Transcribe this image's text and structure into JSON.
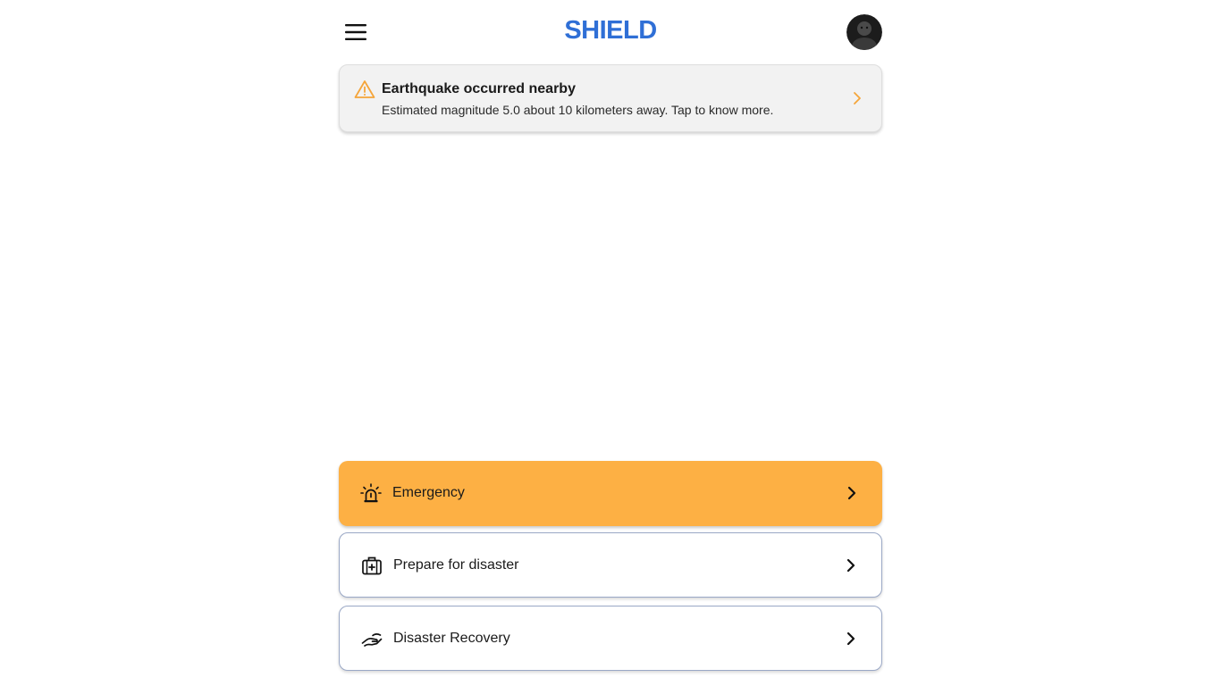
{
  "header": {
    "logo": "SHIELD",
    "menu_icon": "hamburger-menu-icon",
    "avatar_icon": "user-avatar"
  },
  "alert": {
    "icon": "warning-triangle-icon",
    "title": "Earthquake occurred nearby",
    "description": "Estimated magnitude 5.0 about 10 kilometers away. Tap to know more.",
    "accent_color": "#f5a53a"
  },
  "actions": [
    {
      "label": "Emergency",
      "icon": "siren-icon",
      "style": "primary",
      "color": "#fdb044"
    },
    {
      "label": "Prepare for disaster",
      "icon": "first-aid-kit-icon",
      "style": "secondary"
    },
    {
      "label": "Disaster Recovery",
      "icon": "helping-hand-icon",
      "style": "secondary"
    }
  ],
  "colors": {
    "brand": "#2f6fd6",
    "primary_action": "#fdb044",
    "alert_background": "#f2f2f2"
  }
}
